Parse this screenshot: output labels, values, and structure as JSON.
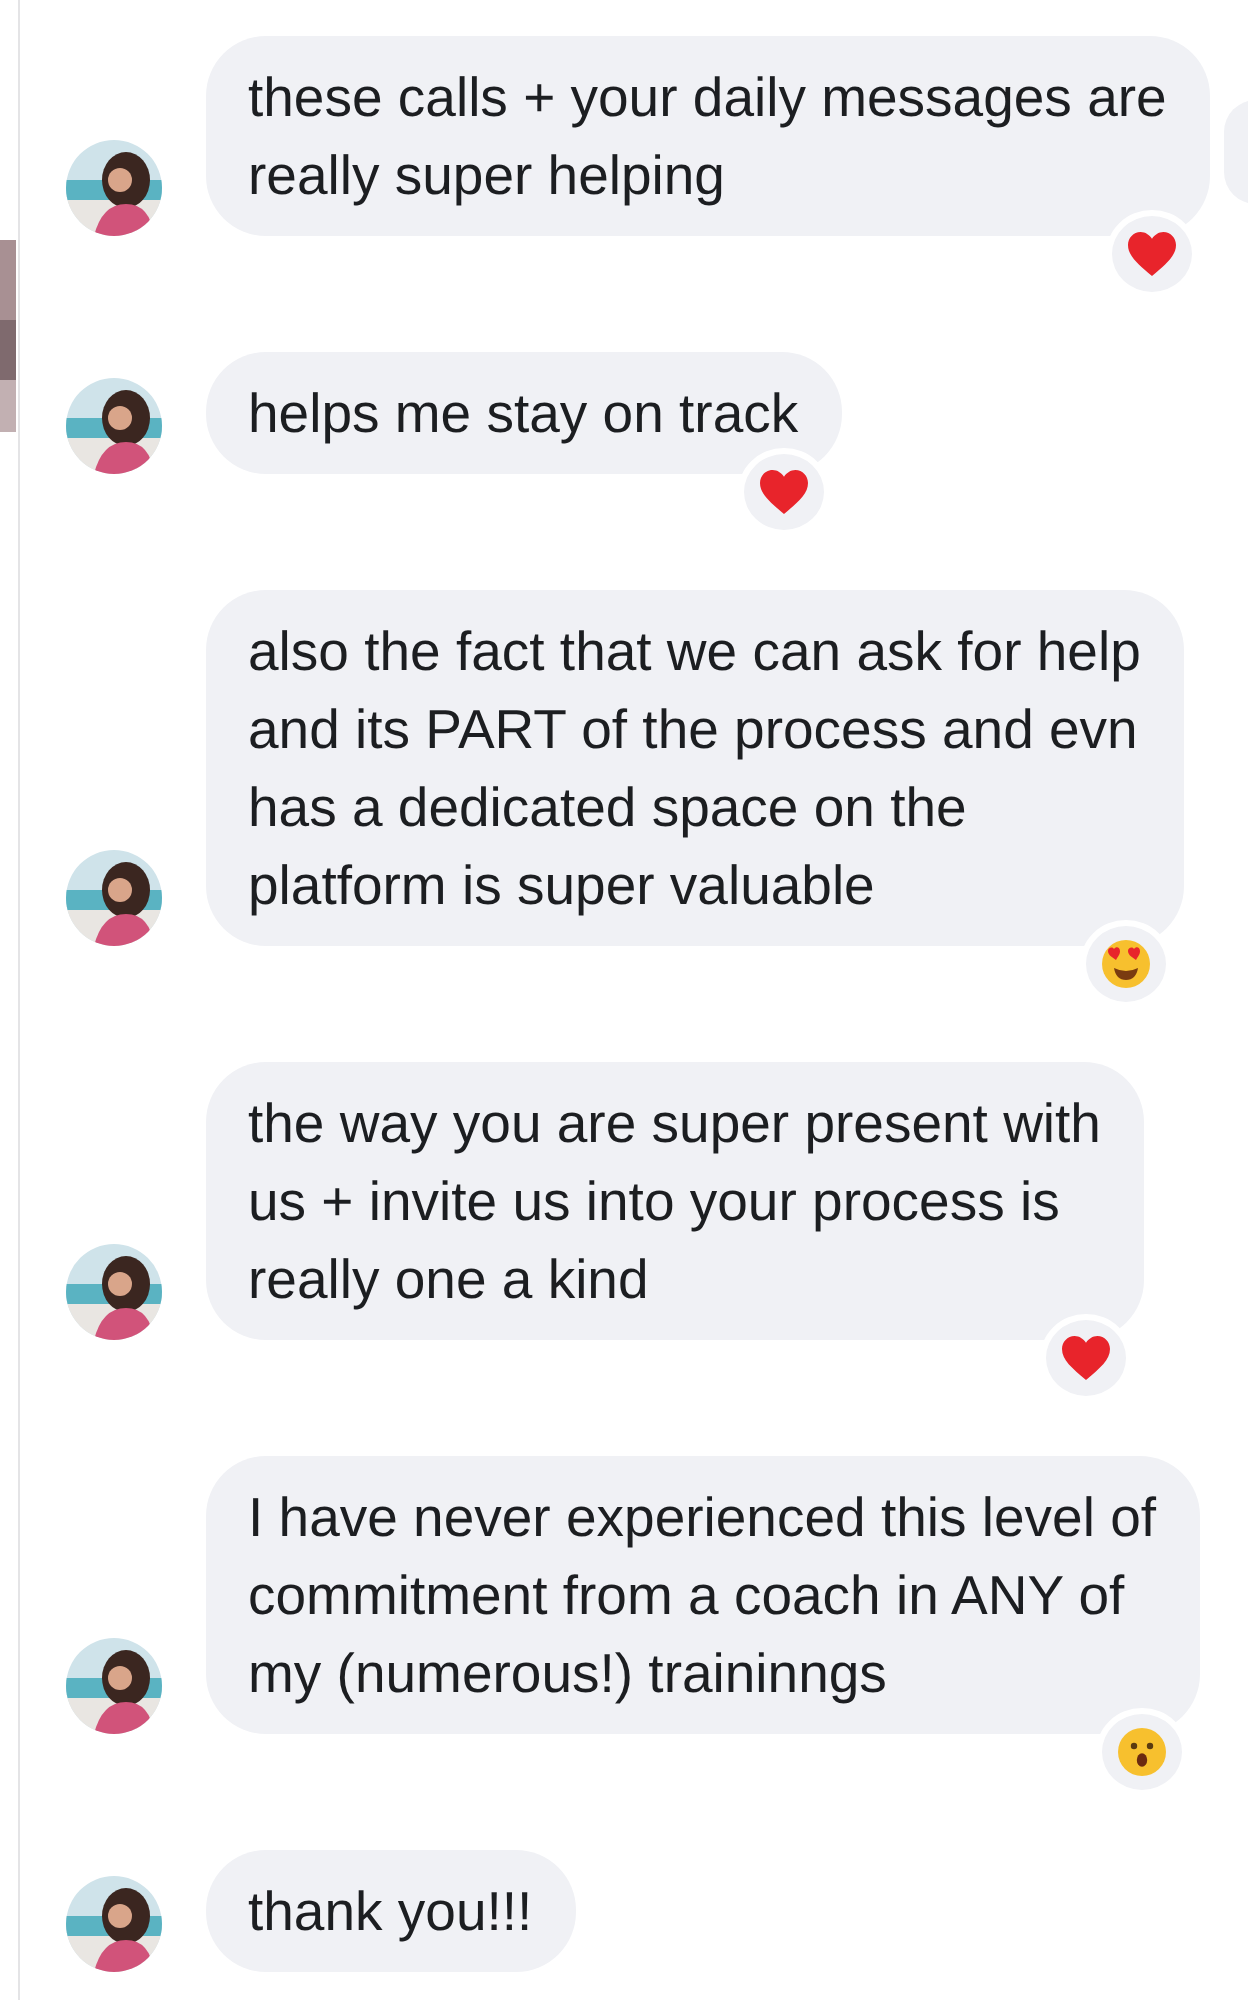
{
  "messages": [
    {
      "lines": [
        "these calls + your daily messages are",
        "really super helping"
      ],
      "reaction": {
        "kind": "heart"
      }
    },
    {
      "lines": [
        "helps me stay on track"
      ],
      "reaction": {
        "kind": "heart"
      }
    },
    {
      "lines": [
        "also the fact that we can ask for help",
        "and its PART of the process and evn",
        "has a dedicated space on the",
        "platform is super valuable"
      ],
      "reaction": {
        "kind": "heart-eyes"
      }
    },
    {
      "lines": [
        "the way you are super present with",
        "us + invite us into your process is",
        "really one a kind"
      ],
      "reaction": {
        "kind": "heart"
      }
    },
    {
      "lines": [
        "I have never experienced this level of",
        "commitment from a coach in ANY of",
        "my (numerous!) traininngs"
      ],
      "reaction": {
        "kind": "surprised"
      }
    },
    {
      "lines": [
        "thank you!!!"
      ]
    }
  ]
}
